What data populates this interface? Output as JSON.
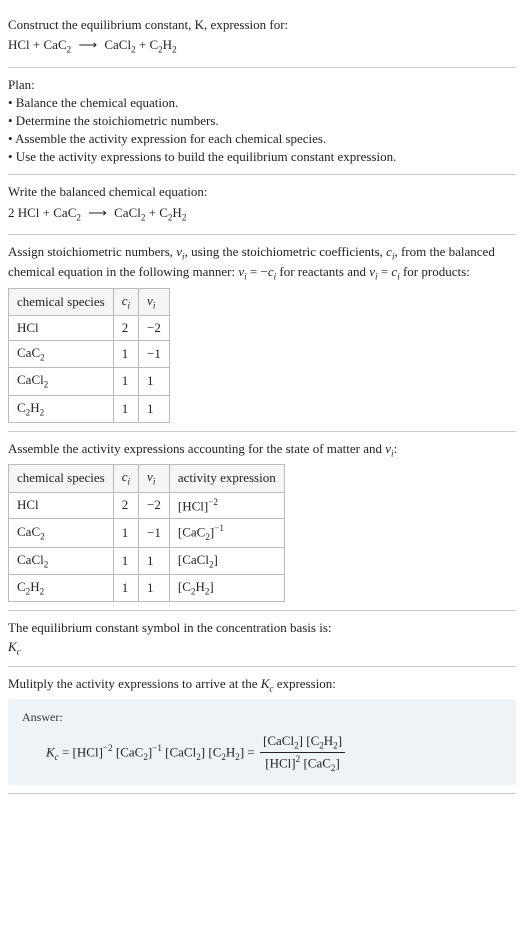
{
  "problem": {
    "title": "Construct the equilibrium constant, K, expression for:",
    "eq_lhs1": "HCl",
    "eq_lhs2": "CaC",
    "eq_lhs2_sub": "2",
    "eq_rhs1": "CaCl",
    "eq_rhs1_sub": "2",
    "eq_rhs2": "C",
    "eq_rhs2_sub1": "2",
    "eq_rhs2_mid": "H",
    "eq_rhs2_sub2": "2"
  },
  "plan": {
    "label": "Plan:",
    "b1": "• Balance the chemical equation.",
    "b2": "• Determine the stoichiometric numbers.",
    "b3": "• Assemble the activity expression for each chemical species.",
    "b4": "• Use the activity expressions to build the equilibrium constant expression."
  },
  "balanced": {
    "intro": "Write the balanced chemical equation:",
    "coef": "2"
  },
  "stoich": {
    "intro_part1": "Assign stoichiometric numbers, ",
    "intro_part2": ", using the stoichiometric coefficients, ",
    "intro_part3": ", from the balanced chemical equation in the following manner: ",
    "intro_part4": " for reactants and ",
    "intro_part5": " for products:",
    "nu": "ν",
    "nu_i": "i",
    "c": "c",
    "c_i": "i",
    "eq1": " = −",
    "eq2": " = ",
    "headers": {
      "species": "chemical species",
      "ci": "c",
      "ci_sub": "i",
      "vi": "ν",
      "vi_sub": "i"
    },
    "rows": [
      {
        "sp": "HCl",
        "sp_sub": "",
        "ci": "2",
        "vi": "−2"
      },
      {
        "sp": "CaC",
        "sp_sub": "2",
        "ci": "1",
        "vi": "−1"
      },
      {
        "sp": "CaCl",
        "sp_sub": "2",
        "ci": "1",
        "vi": "1"
      },
      {
        "sp": "C₂H",
        "sp_sub": "2",
        "sp_pre": "C",
        "sp_presub": "2",
        "sp_mid": "H",
        "ci": "1",
        "vi": "1"
      }
    ]
  },
  "activity": {
    "intro_part1": "Assemble the activity expressions accounting for the state of matter and ",
    "intro_part2": ":",
    "headers": {
      "species": "chemical species",
      "ci": "c",
      "ci_sub": "i",
      "vi": "ν",
      "vi_sub": "i",
      "act": "activity expression"
    }
  },
  "act_rows": {
    "r0_ci": "2",
    "r0_vi": "−2",
    "r0_exp": "−2",
    "r1_ci": "1",
    "r1_vi": "−1",
    "r1_exp": "−1",
    "r2_ci": "1",
    "r2_vi": "1",
    "r3_ci": "1",
    "r3_vi": "1"
  },
  "kc_symbol": {
    "intro": "The equilibrium constant symbol in the concentration basis is:",
    "K": "K",
    "c": "c"
  },
  "final": {
    "intro_part1": "Mulitply the activity expressions to arrive at the ",
    "intro_part2": " expression:",
    "answer_label": "Answer:",
    "exp_n2": "−2",
    "exp_n1": "−1",
    "two": "2"
  },
  "chart_data": {
    "type": "table",
    "tables": [
      {
        "title": "Stoichiometric numbers",
        "columns": [
          "chemical species",
          "c_i",
          "ν_i"
        ],
        "rows": [
          [
            "HCl",
            2,
            -2
          ],
          [
            "CaC2",
            1,
            -1
          ],
          [
            "CaCl2",
            1,
            1
          ],
          [
            "C2H2",
            1,
            1
          ]
        ]
      },
      {
        "title": "Activity expressions",
        "columns": [
          "chemical species",
          "c_i",
          "ν_i",
          "activity expression"
        ],
        "rows": [
          [
            "HCl",
            2,
            -2,
            "[HCl]^-2"
          ],
          [
            "CaC2",
            1,
            -1,
            "[CaC2]^-1"
          ],
          [
            "CaCl2",
            1,
            1,
            "[CaCl2]"
          ],
          [
            "C2H2",
            1,
            1,
            "[C2H2]"
          ]
        ]
      }
    ]
  }
}
